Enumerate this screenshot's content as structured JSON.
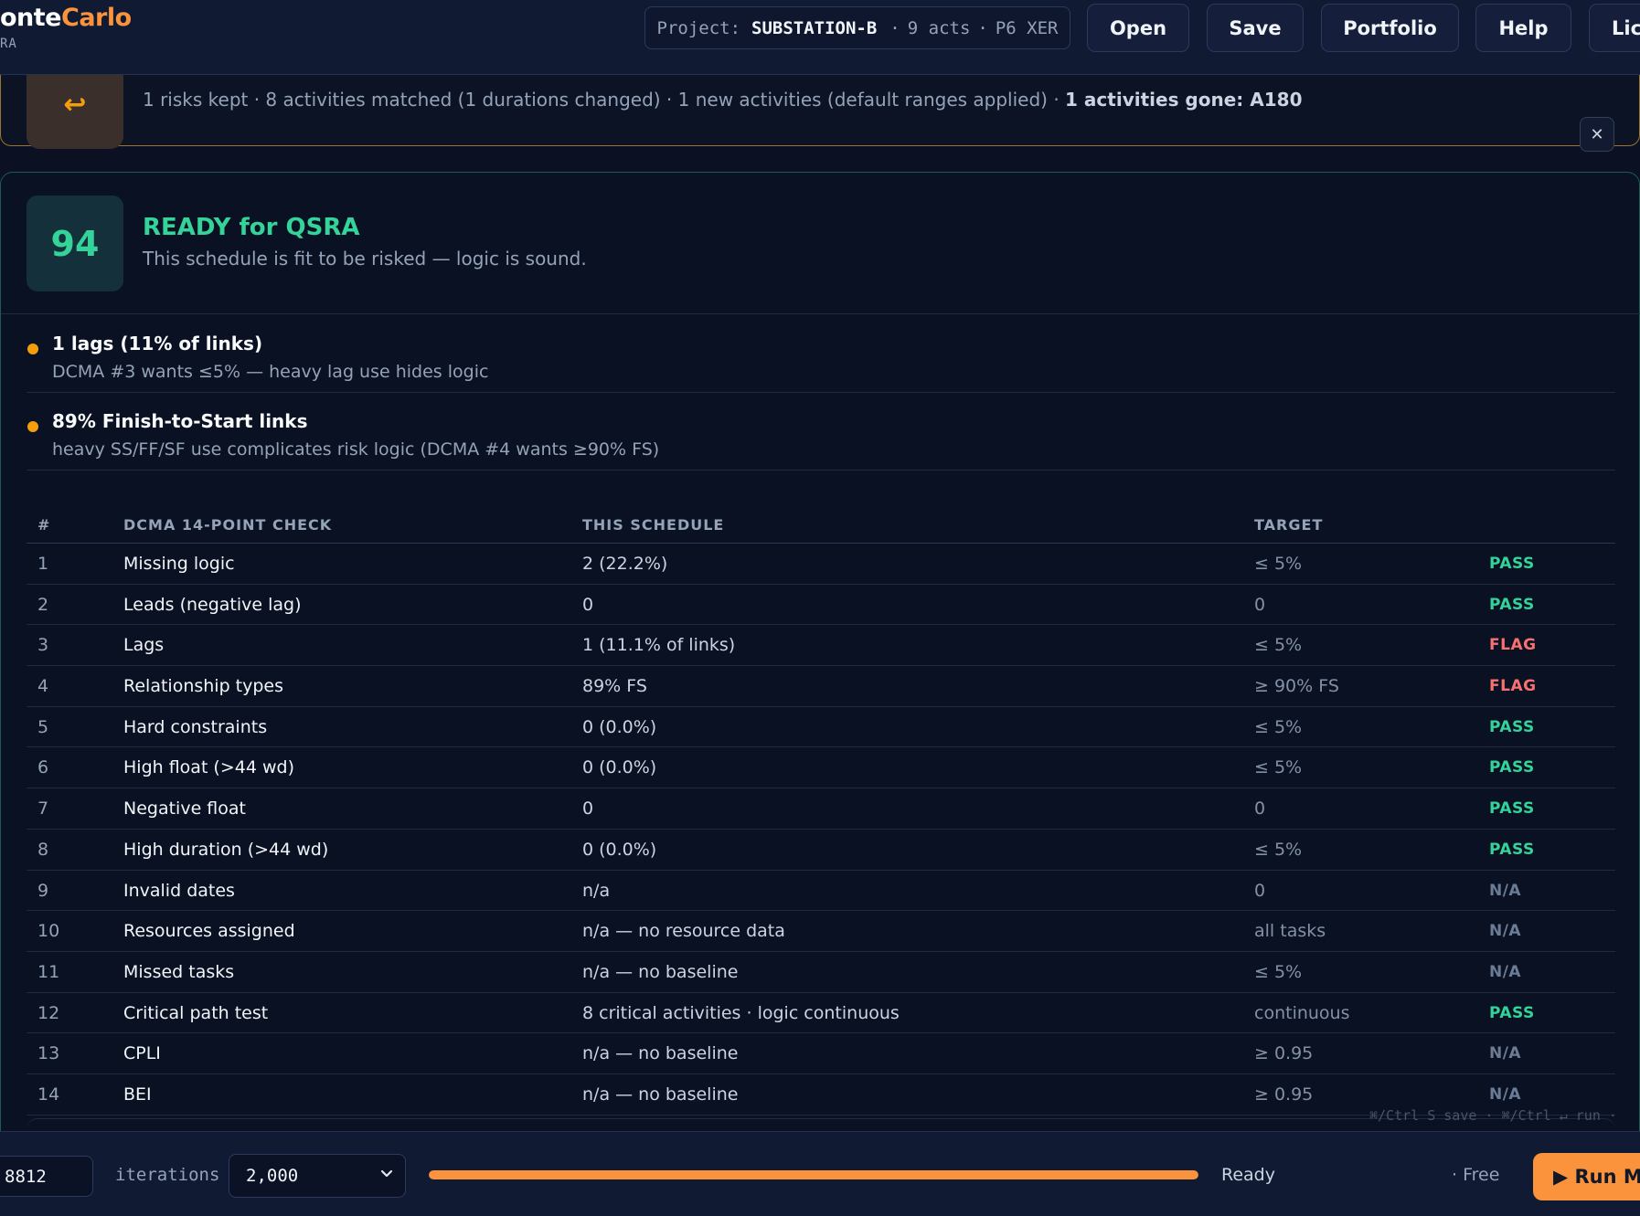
{
  "brand": {
    "name_main": "onte",
    "name_accent": "Carlo",
    "subtitle": "RA"
  },
  "header": {
    "project_label": "Project:",
    "project_name": "SUBSTATION-B",
    "project_acts": "9 acts",
    "project_format": "P6 XER",
    "separator": "·",
    "buttons": {
      "open": "Open",
      "save": "Save",
      "portfolio": "Portfolio",
      "help": "Help",
      "license": "Lic"
    }
  },
  "banner": {
    "icon_glyph": "↩",
    "text": "1 risks kept · 8 activities matched (1 durations changed) · 1 new activities (default ranges applied) ·",
    "text_bold": "1 activities gone: A180",
    "close_glyph": "✕"
  },
  "readiness": {
    "score": "94",
    "title": "READY for QSRA",
    "subtitle": "This schedule is fit to be risked — logic is sound."
  },
  "warnings": [
    {
      "title": "1 lags (11% of links)",
      "desc": "DCMA #3 wants ≤5% — heavy lag use hides logic"
    },
    {
      "title": "89% Finish-to-Start links",
      "desc": "heavy SS/FF/SF use complicates risk logic (DCMA #4 wants ≥90% FS)"
    }
  ],
  "dcma": {
    "headers": {
      "num": "#",
      "check": "DCMA 14-POINT CHECK",
      "schedule": "THIS SCHEDULE",
      "target": "TARGET"
    },
    "rows": [
      {
        "num": "1",
        "check": "Missing logic",
        "value": "2 (22.2%)",
        "target": "≤ 5%",
        "status": "PASS"
      },
      {
        "num": "2",
        "check": "Leads (negative lag)",
        "value": "0",
        "target": "0",
        "status": "PASS"
      },
      {
        "num": "3",
        "check": "Lags",
        "value": "1 (11.1% of links)",
        "target": "≤ 5%",
        "status": "FLAG"
      },
      {
        "num": "4",
        "check": "Relationship types",
        "value": "89% FS",
        "target": "≥ 90% FS",
        "status": "FLAG"
      },
      {
        "num": "5",
        "check": "Hard constraints",
        "value": "0 (0.0%)",
        "target": "≤ 5%",
        "status": "PASS"
      },
      {
        "num": "6",
        "check": "High float (>44 wd)",
        "value": "0 (0.0%)",
        "target": "≤ 5%",
        "status": "PASS"
      },
      {
        "num": "7",
        "check": "Negative float",
        "value": "0",
        "target": "0",
        "status": "PASS"
      },
      {
        "num": "8",
        "check": "High duration (>44 wd)",
        "value": "0 (0.0%)",
        "target": "≤ 5%",
        "status": "PASS"
      },
      {
        "num": "9",
        "check": "Invalid dates",
        "value": "n/a",
        "target": "0",
        "status": "N/A"
      },
      {
        "num": "10",
        "check": "Resources assigned",
        "value": "n/a — no resource data",
        "target": "all tasks",
        "status": "N/A"
      },
      {
        "num": "11",
        "check": "Missed tasks",
        "value": "n/a — no baseline",
        "target": "≤ 5%",
        "status": "N/A"
      },
      {
        "num": "12",
        "check": "Critical path test",
        "value": "8 critical activities · logic continuous",
        "target": "continuous",
        "status": "PASS"
      },
      {
        "num": "13",
        "check": "CPLI",
        "value": "n/a — no baseline",
        "target": "≥ 0.95",
        "status": "N/A"
      },
      {
        "num": "14",
        "check": "BEI",
        "value": "n/a — no baseline",
        "target": "≥ 0.95",
        "status": "N/A"
      }
    ]
  },
  "shortcuts": "⌘/Ctrl S save · ⌘/Ctrl ↵ run ·",
  "footer": {
    "seed_value": "8812",
    "iterations_label": "iterations",
    "iterations_value": "2,000",
    "progress_fraction": 1.0,
    "status": "Ready",
    "plan": "· Free",
    "run_label": "▶ Run M"
  },
  "colors": {
    "accent": "#fb923c",
    "pass": "#34d399",
    "flag": "#f87171",
    "na": "#6b7c97",
    "warn": "#f59e0b"
  }
}
